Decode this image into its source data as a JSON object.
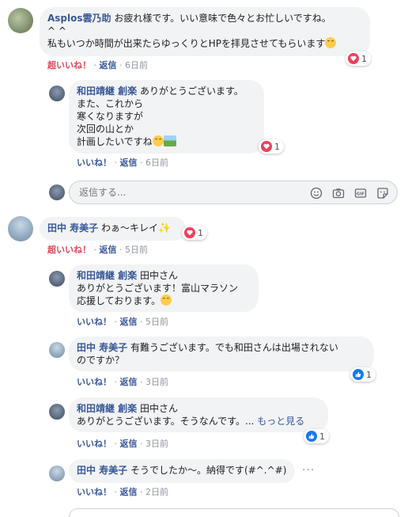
{
  "comments": [
    {
      "name": "Asplos雲乃助",
      "text": "お疲れ様です。いい意味で色々とお忙しいですね。\n^ ^\n私もいつか時間が出来たらゆっくりとHPを拝見させてもらいます",
      "like_label": "超いいね！",
      "reply_label": "返信",
      "time": "6日前",
      "reaction_count": "1"
    },
    {
      "name": "和田靖継 創楽",
      "text_first": "ありがとうございます。",
      "text_rest": "また、これから\n寒くなりますが\n次回の山とか\n計画したいですね",
      "like_label": "いいね！",
      "reply_label": "返信",
      "time": "6日前",
      "reaction_count": "1"
    },
    {
      "name": "田中 寿美子",
      "text": "わぁ～キレイ",
      "like_label": "超いいね！",
      "reply_label": "返信",
      "time": "5日前",
      "reaction_count": "1"
    },
    {
      "name": "和田靖継 創楽",
      "mention": "田中さん",
      "text": "ありがとうございます！富山マラソン\n応援しております。",
      "like_label": "いいね！",
      "reply_label": "返信",
      "time": "5日前"
    },
    {
      "name": "田中 寿美子",
      "text_first": "有難うございます。でも和田さんは出場されない",
      "text_rest": "のですか？",
      "like_label": "いいね！",
      "reply_label": "返信",
      "time": "3日前",
      "reaction_count": "1"
    },
    {
      "name": "和田靖継 創楽",
      "mention": "田中さん",
      "text": "ありがとうございます。そうなんです。...",
      "more": "もっと見る",
      "like_label": "いいね！",
      "reply_label": "返信",
      "time": "3日前",
      "reaction_count": "1"
    },
    {
      "name": "田中 寿美子",
      "text": "そうでしたか～。納得です(#^.^#)",
      "like_label": "いいね！",
      "reply_label": "返信",
      "time": "2日前"
    }
  ],
  "reply_box": {
    "placeholder": "返信する..."
  },
  "separator": "·",
  "icons": {
    "reply_box": [
      "emoji-icon",
      "camera-icon",
      "gif-icon",
      "sticker-icon"
    ],
    "reactions": [
      "love-icon",
      "like-icon"
    ]
  },
  "colors": {
    "link": "#385898",
    "super_like": "#e9445a",
    "love": "#f33e58",
    "like": "#1877f2",
    "bubble": "#f2f3f5"
  }
}
